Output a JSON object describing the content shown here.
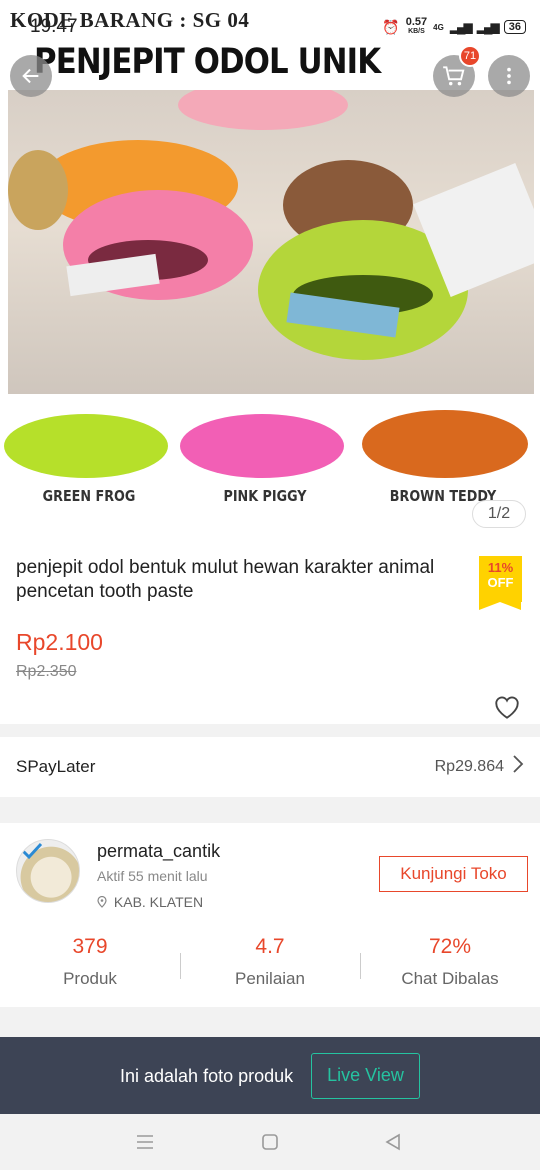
{
  "status_bar": {
    "time": "19.47",
    "network_speed": "0.57",
    "network_unit": "KB/S",
    "network_type": "4G",
    "battery": "36"
  },
  "product_image": {
    "overlay_code": "KODE BARANG : SG 04",
    "overlay_title": "PENJEPIT ODOL UNIK",
    "variants": [
      "GREEN FROG",
      "PINK PIGGY",
      "BROWN TEDDY"
    ],
    "counter": "1/2"
  },
  "header": {
    "cart_count": "71"
  },
  "product": {
    "title": "penjepit odol bentuk mulut hewan karakter animal pencetan tooth paste",
    "discount_pct": "11%",
    "discount_label": "OFF",
    "price": "Rp2.100",
    "original_price": "Rp2.350"
  },
  "paylater": {
    "label": "SPayLater",
    "amount": "Rp29.864"
  },
  "shop": {
    "name": "permata_cantik",
    "active": "Aktif 55 menit lalu",
    "location": "KAB. KLATEN",
    "visit_label": "Kunjungi Toko",
    "stats": [
      {
        "value": "379",
        "label": "Produk"
      },
      {
        "value": "4.7",
        "label": "Penilaian"
      },
      {
        "value": "72%",
        "label": "Chat Dibalas"
      }
    ]
  },
  "photo_bar": {
    "text": "Ini adalah foto produk",
    "button": "Live View"
  },
  "colors": {
    "accent": "#e8472b",
    "badge_yellow": "#ffd200",
    "bar_dark": "#3d4455",
    "live_teal": "#25c3a0"
  }
}
